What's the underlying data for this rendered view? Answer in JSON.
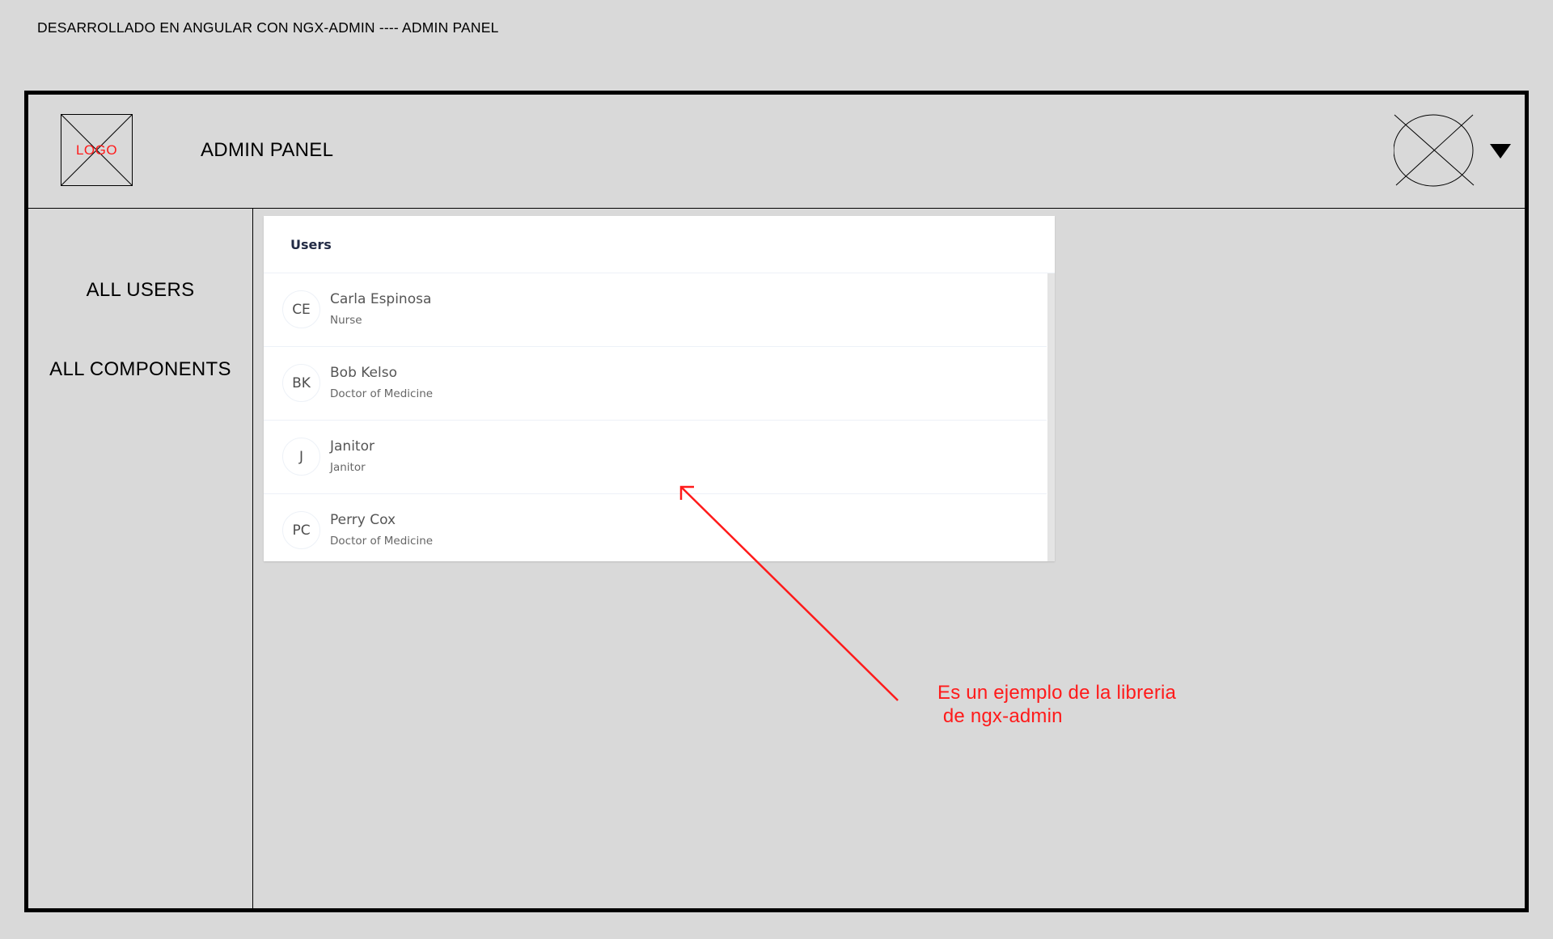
{
  "caption": "DESARROLLADO EN ANGULAR CON NGX-ADMIN ---- ADMIN PANEL",
  "header": {
    "logo_text": "LOGO",
    "title": "ADMIN PANEL",
    "avatar_icon": "placeholder-image-icon",
    "dropdown_icon": "caret-down-icon"
  },
  "sidebar": {
    "items": [
      {
        "label": "ALL USERS"
      },
      {
        "label": "ALL COMPONENTS"
      }
    ]
  },
  "users_card": {
    "title": "Users",
    "users": [
      {
        "initials": "CE",
        "name": "Carla Espinosa",
        "role": "Nurse"
      },
      {
        "initials": "BK",
        "name": "Bob Kelso",
        "role": "Doctor of Medicine"
      },
      {
        "initials": "J",
        "name": "Janitor",
        "role": "Janitor"
      },
      {
        "initials": "PC",
        "name": "Perry Cox",
        "role": "Doctor of Medicine"
      }
    ]
  },
  "annotation": {
    "line1": "Es un ejemplo de la libreria",
    "line2": " de ngx-admin",
    "color": "#ff1a1a"
  }
}
